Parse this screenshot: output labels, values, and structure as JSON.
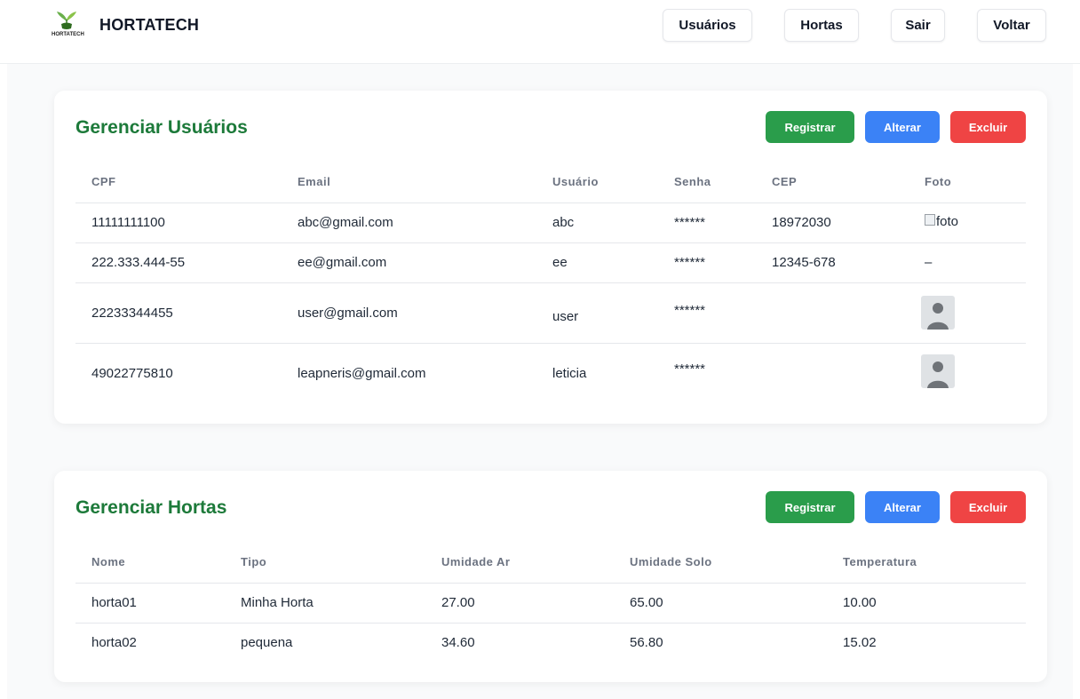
{
  "header": {
    "brand": "HORTATECH",
    "logo_text": "HORTATECH",
    "nav": [
      {
        "label": "Usuários"
      },
      {
        "label": "Hortas"
      },
      {
        "label": "Sair"
      },
      {
        "label": "Voltar"
      }
    ]
  },
  "users": {
    "title": "Gerenciar Usuários",
    "buttons": {
      "register": "Registrar",
      "edit": "Alterar",
      "delete": "Excluir"
    },
    "columns": [
      "CPF",
      "Email",
      "Usuário",
      "Senha",
      "CEP",
      "Foto"
    ],
    "rows": [
      {
        "cpf": "11111111100",
        "email": "abc@gmail.com",
        "user": "abc",
        "password": "******",
        "cep": "18972030",
        "photo": "foto",
        "photo_kind": "broken"
      },
      {
        "cpf": "222.333.444-55",
        "email": "ee@gmail.com",
        "user": "ee",
        "password": "******",
        "cep": "12345-678",
        "photo": "–",
        "photo_kind": "dash"
      },
      {
        "cpf": "22233344455",
        "email": "user@gmail.com",
        "user": "user",
        "password": "******",
        "cep": "",
        "photo": "",
        "photo_kind": "avatar"
      },
      {
        "cpf": "49022775810",
        "email": "leapneris@gmail.com",
        "user": "leticia",
        "password": "******",
        "cep": "",
        "photo": "",
        "photo_kind": "avatar"
      }
    ]
  },
  "gardens": {
    "title": "Gerenciar Hortas",
    "buttons": {
      "register": "Registrar",
      "edit": "Alterar",
      "delete": "Excluir"
    },
    "columns": [
      "Nome",
      "Tipo",
      "Umidade Ar",
      "Umidade Solo",
      "Temperatura"
    ],
    "rows": [
      {
        "name": "horta01",
        "type": "Minha Horta",
        "air_humidity": "27.00",
        "soil_humidity": "65.00",
        "temperature": "10.00"
      },
      {
        "name": "horta02",
        "type": "pequena",
        "air_humidity": "34.60",
        "soil_humidity": "56.80",
        "temperature": "15.02"
      }
    ]
  },
  "colors": {
    "title_green": "#1d7a3a",
    "register": "#2a9d4b",
    "edit": "#3b82f6",
    "delete": "#ef4444"
  }
}
